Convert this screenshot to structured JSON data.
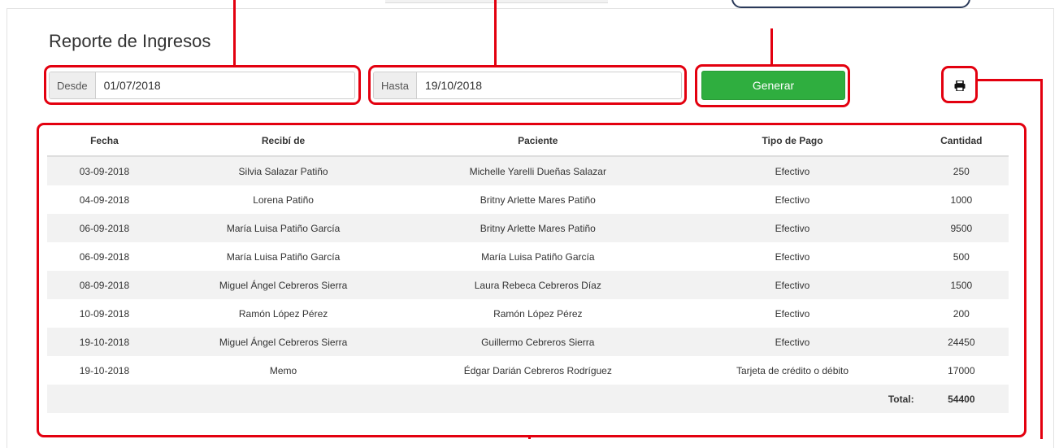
{
  "title": "Reporte de Ingresos",
  "filters": {
    "desde_label": "Desde",
    "desde_value": "01/07/2018",
    "hasta_label": "Hasta",
    "hasta_value": "19/10/2018"
  },
  "generate_label": "Generar",
  "icons": {
    "print": "print-icon"
  },
  "table": {
    "headers": [
      "Fecha",
      "Recibí de",
      "Paciente",
      "Tipo de Pago",
      "Cantidad"
    ],
    "rows": [
      [
        "03-09-2018",
        "Silvia Salazar Patiño",
        "Michelle Yarelli Dueñas Salazar",
        "Efectivo",
        "250"
      ],
      [
        "04-09-2018",
        "Lorena Patiño",
        "Britny Arlette Mares Patiño",
        "Efectivo",
        "1000"
      ],
      [
        "06-09-2018",
        "María Luisa Patiño García",
        "Britny Arlette Mares Patiño",
        "Efectivo",
        "9500"
      ],
      [
        "06-09-2018",
        "María Luisa Patiño García",
        "María Luisa Patiño García",
        "Efectivo",
        "500"
      ],
      [
        "08-09-2018",
        "Miguel Ángel Cebreros Sierra",
        "Laura Rebeca Cebreros Díaz",
        "Efectivo",
        "1500"
      ],
      [
        "10-09-2018",
        "Ramón López Pérez",
        "Ramón López Pérez",
        "Efectivo",
        "200"
      ],
      [
        "19-10-2018",
        "Miguel Ángel Cebreros Sierra",
        "Guillermo Cebreros Sierra",
        "Efectivo",
        "24450"
      ],
      [
        "19-10-2018",
        "Memo",
        "Édgar Darián Cebreros Rodríguez",
        "Tarjeta de crédito o débito",
        "17000"
      ]
    ],
    "total_label": "Total:",
    "total_value": "54400"
  },
  "colors": {
    "annotation": "#e3000f",
    "button": "#2fae3f"
  }
}
